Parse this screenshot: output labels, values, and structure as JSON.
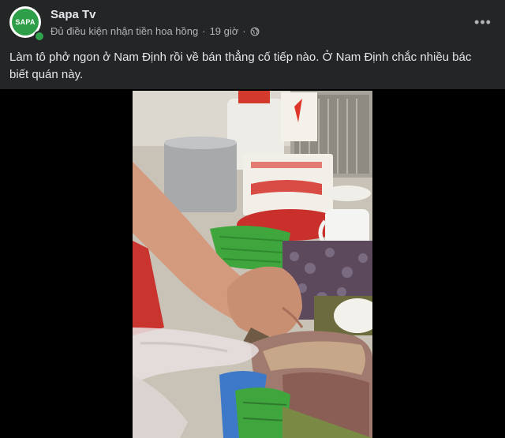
{
  "author": {
    "name": "Sapa Tv",
    "avatar_text": "SAPA"
  },
  "meta": {
    "eligibility": "Đủ điều kiện nhận tiền hoa hồng",
    "separator": "·",
    "time": "19 giờ",
    "separator2": "·",
    "privacy_icon": "globe-icon"
  },
  "menu": {
    "more_label": "•••"
  },
  "post": {
    "caption": "Làm tô phở ngon ở Nam Định rồi về bán thẳng cố tiếp nào. Ở Nam Định chắc nhiều bác biết quán này."
  },
  "colors": {
    "background": "#242526",
    "primary_text": "#e4e6eb",
    "secondary_text": "#b0b3b8",
    "brand_green": "#2e9f48",
    "online": "#31a24c"
  }
}
